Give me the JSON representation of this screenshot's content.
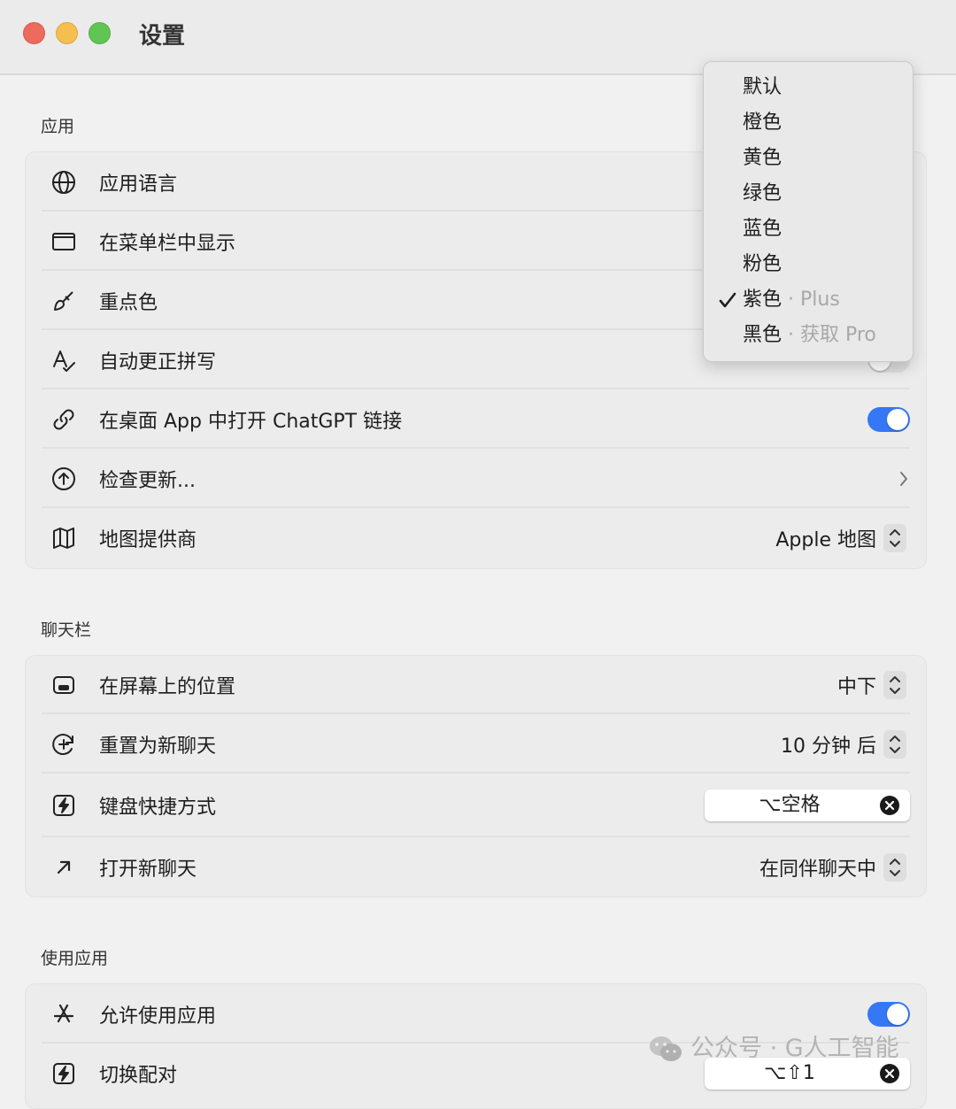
{
  "window": {
    "title": "设置"
  },
  "sections": {
    "app": {
      "label": "应用",
      "rows": {
        "language": {
          "label": "应用语言",
          "icon": "globe-icon"
        },
        "menubar": {
          "label": "在菜单栏中显示",
          "icon": "window-icon"
        },
        "accent": {
          "label": "重点色",
          "icon": "paintbrush-icon"
        },
        "spelling": {
          "label": "自动更正拼写",
          "icon": "spellcheck-icon",
          "toggle": false
        },
        "open_links": {
          "label": "在桌面 App 中打开 ChatGPT 链接",
          "icon": "link-icon",
          "toggle": true
        },
        "updates": {
          "label": "检查更新...",
          "icon": "arrow-up-circle-icon"
        },
        "map": {
          "label": "地图提供商",
          "icon": "map-icon",
          "value": "Apple 地图"
        }
      }
    },
    "chatbar": {
      "label": "聊天栏",
      "rows": {
        "position": {
          "label": "在屏幕上的位置",
          "icon": "screen-position-icon",
          "value": "中下"
        },
        "reset": {
          "label": "重置为新聊天",
          "icon": "new-chat-icon",
          "value": "10 分钟 后"
        },
        "shortcut": {
          "label": "键盘快捷方式",
          "icon": "bolt-key-icon",
          "keys": "⌥空格"
        },
        "open_new": {
          "label": "打开新聊天",
          "icon": "arrow-up-right-icon",
          "value": "在同伴聊天中"
        }
      }
    },
    "use_apps": {
      "label": "使用应用",
      "rows": {
        "allow": {
          "label": "允许使用应用",
          "icon": "app-store-icon",
          "toggle": true
        },
        "pair": {
          "label": "切换配对",
          "icon": "bolt-key-icon",
          "keys": "⌥⇧1"
        }
      }
    }
  },
  "accent_menu": {
    "items": [
      {
        "name": "默认",
        "note": "",
        "checked": false
      },
      {
        "name": "橙色",
        "note": "",
        "checked": false
      },
      {
        "name": "黄色",
        "note": "",
        "checked": false
      },
      {
        "name": "绿色",
        "note": "",
        "checked": false
      },
      {
        "name": "蓝色",
        "note": "",
        "checked": false
      },
      {
        "name": "粉色",
        "note": "",
        "checked": false
      },
      {
        "name": "紫色",
        "note": " · Plus",
        "checked": true
      },
      {
        "name": "黑色",
        "note": " · 获取 Pro",
        "checked": false
      }
    ]
  },
  "watermark": {
    "text": "公众号 · G人工智能"
  },
  "colors": {
    "toggle_on": "#3478f6",
    "background": "#f1f1f1",
    "group": "#ececec"
  }
}
